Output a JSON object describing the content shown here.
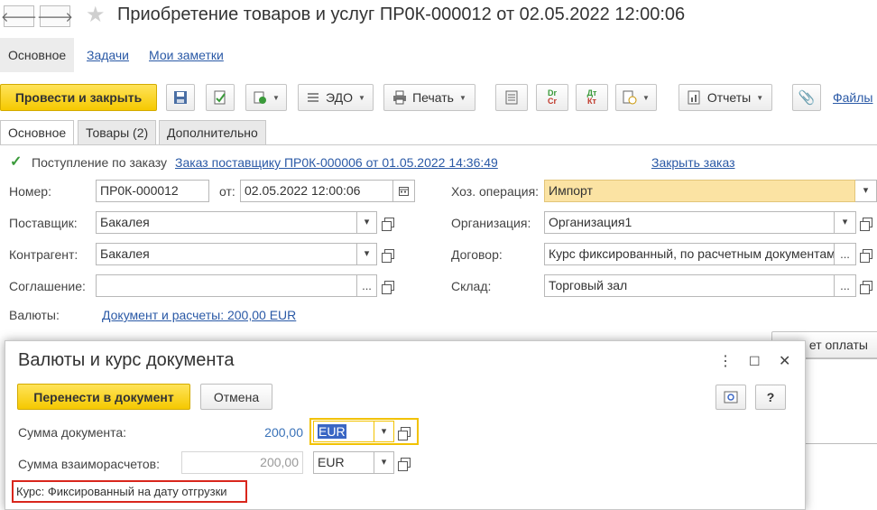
{
  "window": {
    "title": "Приобретение товаров и услуг ПР0К-000012 от 02.05.2022 12:00:06",
    "back_glyph": "🡐",
    "forward_glyph": "🡒",
    "star_glyph": "★"
  },
  "nav": {
    "tabs": [
      {
        "label": "Основное",
        "active": true
      },
      {
        "label": "Задачи"
      },
      {
        "label": "Мои заметки"
      }
    ]
  },
  "toolbar": {
    "post_close": "Провести и закрыть",
    "edo": "ЭДО",
    "print": "Печать",
    "dr_top": "Dr",
    "dr_bottom": "Cr",
    "dt_top": "Дт",
    "dt_bottom": "Кт",
    "reports": "Отчеты",
    "files": "Файлы"
  },
  "subtabs": [
    {
      "label": "Основное",
      "active": true
    },
    {
      "label": "Товары (2)"
    },
    {
      "label": "Дополнительно"
    }
  ],
  "form": {
    "by_order_label": "Поступление по заказу",
    "order_link": "Заказ поставщику ПР0К-000006 от 01.05.2022 14:36:49",
    "close_order_link": "Закрыть заказ",
    "number_label": "Номер:",
    "number_value": "ПР0К-000012",
    "date_label": "от:",
    "date_value": "02.05.2022 12:00:06",
    "operation_label": "Хоз. операция:",
    "operation_value": "Импорт",
    "supplier_label": "Поставщик:",
    "supplier_value": "Бакалея",
    "organization_label": "Организация:",
    "organization_value": "Организация1",
    "counterparty_label": "Контрагент:",
    "counterparty_value": "Бакалея",
    "contract_label": "Договор:",
    "contract_value": "Курс фиксированный, по расчетным документам",
    "agreement_label": "Соглашение:",
    "agreement_value": "",
    "warehouse_label": "Склад:",
    "warehouse_value": "Торговый зал",
    "currencies_label": "Валюты:",
    "currencies_link": "Документ и расчеты: 200,00 EUR",
    "payment_button_partial": "ет оплаты",
    "ellipsis": "...",
    "caret": "▾"
  },
  "dialog": {
    "title": "Валюты и курс документа",
    "transfer_button": "Перенести в документ",
    "cancel_button": "Отмена",
    "help_button": "?",
    "more_glyph": "⋮",
    "maximize_glyph": "☐",
    "close_glyph": "✕",
    "doc_sum_label": "Сумма документа:",
    "doc_sum_value": "200,00",
    "doc_currency": "EUR",
    "settlement_sum_label": "Сумма взаиморасчетов:",
    "settlement_sum_value": "200,00",
    "settlement_currency": "EUR",
    "rate_text": "Курс: Фиксированный на дату отгрузки"
  },
  "colors": {
    "accent_yellow": "#f5c900",
    "link_blue": "#2a59a6",
    "highlight_red": "#d9261c",
    "selection_blue": "#3a66c4"
  }
}
